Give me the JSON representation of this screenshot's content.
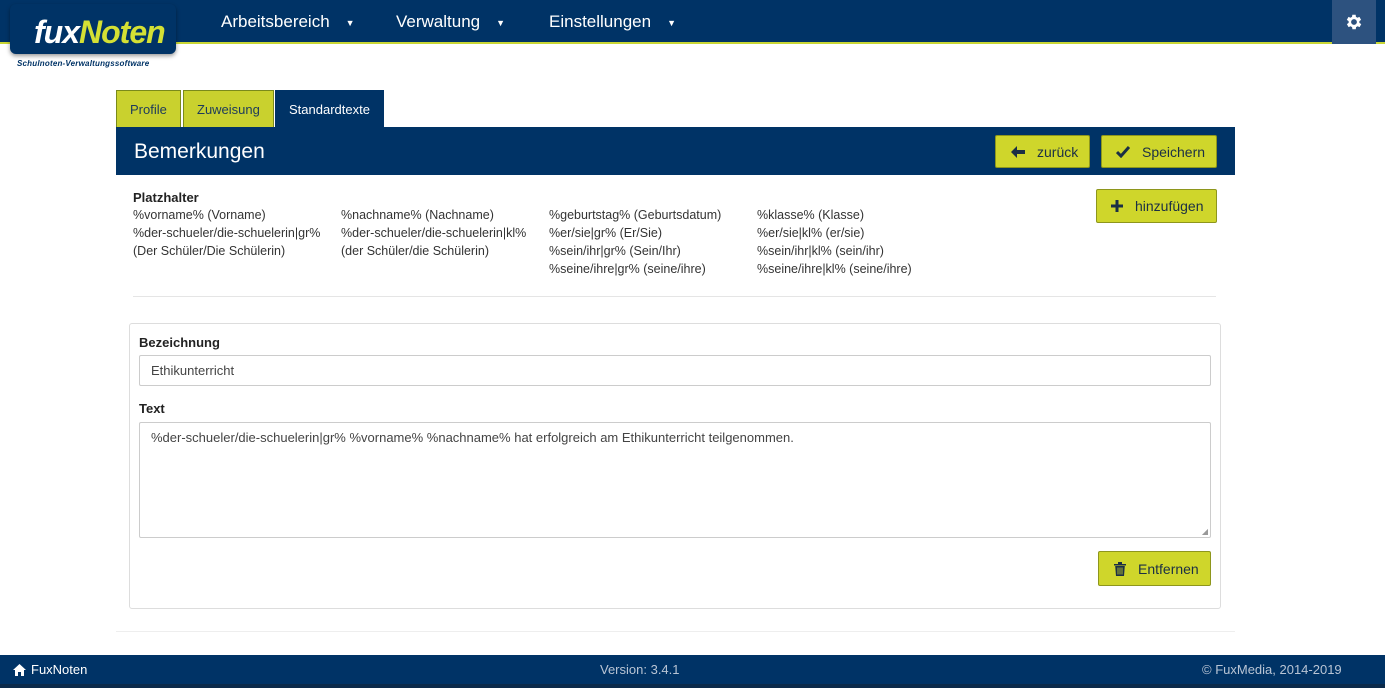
{
  "brand": {
    "name_part1": "fux",
    "name_part2": "Noten",
    "tagline": "Schulnoten-Verwaltungssoftware"
  },
  "nav": {
    "items": [
      {
        "label": "Arbeitsbereich"
      },
      {
        "label": "Verwaltung"
      },
      {
        "label": "Einstellungen"
      }
    ],
    "settings_icon": "gear-icon"
  },
  "tabs": [
    {
      "label": "Profile",
      "active": false
    },
    {
      "label": "Zuweisung",
      "active": false
    },
    {
      "label": "Standardtexte",
      "active": true
    }
  ],
  "panel": {
    "title": "Bemerkungen",
    "back_label": "zurück",
    "save_label": "Speichern",
    "add_label": "hinzufügen"
  },
  "placeholders": {
    "title": "Platzhalter",
    "columns": [
      [
        "%vorname% (Vorname)",
        "%der-schueler/die-schuelerin|gr% (Der Schüler/Die Schülerin)"
      ],
      [
        "%nachname% (Nachname)",
        "%der-schueler/die-schuelerin|kl% (der Schüler/die Schülerin)"
      ],
      [
        "%geburtstag% (Geburtsdatum)",
        "%er/sie|gr% (Er/Sie)",
        "%sein/ihr|gr% (Sein/Ihr)",
        "%seine/ihre|gr% (seine/ihre)"
      ],
      [
        "%klasse% (Klasse)",
        "%er/sie|kl% (er/sie)",
        "%sein/ihr|kl% (sein/ihr)",
        "%seine/ihre|kl% (seine/ihre)"
      ]
    ]
  },
  "form": {
    "bezeichnung_label": "Bezeichnung",
    "bezeichnung_value": "Ethikunterricht",
    "text_label": "Text",
    "text_value": "%der-schueler/die-schuelerin|gr% %vorname% %nachname% hat erfolgreich am Ethikunterricht teilgenommen.",
    "remove_label": "Entfernen"
  },
  "footer": {
    "home_label": "FuxNoten",
    "version": "Version: 3.4.1",
    "copyright": "© FuxMedia, 2014-2019"
  },
  "colors": {
    "navy": "#003366",
    "lime": "#cfd62b",
    "logo_accent": "#d4e034"
  }
}
